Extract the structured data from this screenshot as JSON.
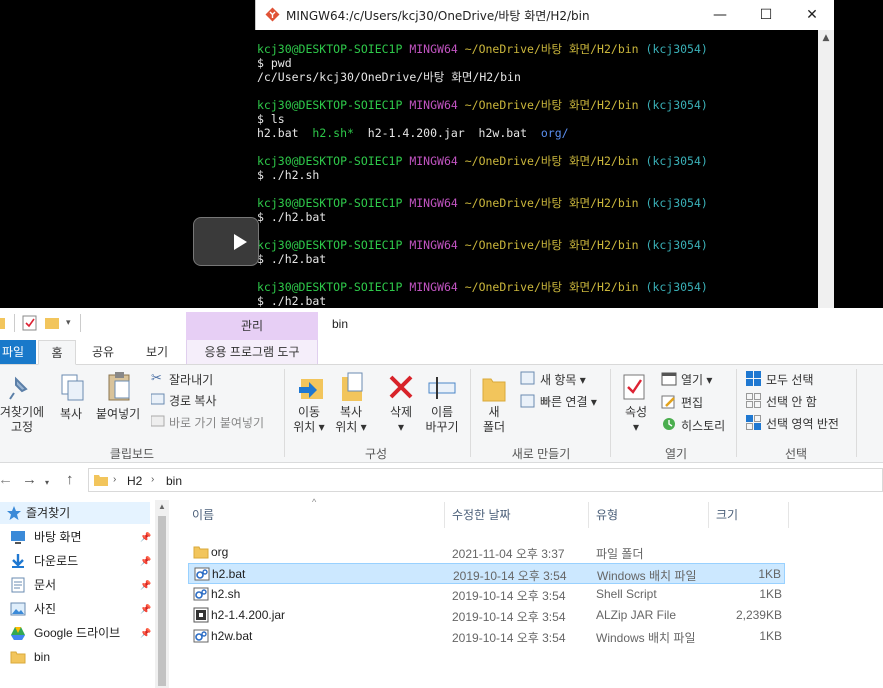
{
  "terminal": {
    "title": "MINGW64:/c/Users/kcj30/OneDrive/바탕 화면/H2/bin",
    "controls": {
      "minimize": "—",
      "maximize": "☐",
      "close": "✕"
    },
    "lines": [
      {
        "parts": [
          {
            "t": "kcj30@DESKTOP-SOIEC1P ",
            "c": "g"
          },
          {
            "t": "MINGW64 ",
            "c": "m"
          },
          {
            "t": "~/OneDrive/바탕 화면/H2/bin ",
            "c": "y"
          },
          {
            "t": "(kcj3054)",
            "c": "c"
          }
        ]
      },
      {
        "parts": [
          {
            "t": "$ pwd"
          }
        ]
      },
      {
        "parts": [
          {
            "t": "/c/Users/kcj30/OneDrive/바탕 화면/H2/bin"
          }
        ]
      },
      {
        "parts": [
          {
            "t": ""
          }
        ]
      },
      {
        "parts": [
          {
            "t": "kcj30@DESKTOP-SOIEC1P ",
            "c": "g"
          },
          {
            "t": "MINGW64 ",
            "c": "m"
          },
          {
            "t": "~/OneDrive/바탕 화면/H2/bin ",
            "c": "y"
          },
          {
            "t": "(kcj3054)",
            "c": "c"
          }
        ]
      },
      {
        "parts": [
          {
            "t": "$ ls"
          }
        ]
      },
      {
        "parts": [
          {
            "t": "h2.bat  "
          },
          {
            "t": "h2.sh*",
            "c": "g"
          },
          {
            "t": "  h2-1.4.200.jar  h2w.bat  "
          },
          {
            "t": "org/",
            "c": "b"
          }
        ]
      },
      {
        "parts": [
          {
            "t": ""
          }
        ]
      },
      {
        "parts": [
          {
            "t": "kcj30@DESKTOP-SOIEC1P ",
            "c": "g"
          },
          {
            "t": "MINGW64 ",
            "c": "m"
          },
          {
            "t": "~/OneDrive/바탕 화면/H2/bin ",
            "c": "y"
          },
          {
            "t": "(kcj3054)",
            "c": "c"
          }
        ]
      },
      {
        "parts": [
          {
            "t": "$ ./h2.sh"
          }
        ]
      },
      {
        "parts": [
          {
            "t": ""
          }
        ]
      },
      {
        "parts": [
          {
            "t": "kcj30@DESKTOP-SOIEC1P ",
            "c": "g"
          },
          {
            "t": "MINGW64 ",
            "c": "m"
          },
          {
            "t": "~/OneDrive/바탕 화면/H2/bin ",
            "c": "y"
          },
          {
            "t": "(kcj3054)",
            "c": "c"
          }
        ]
      },
      {
        "parts": [
          {
            "t": "$ ./h2.bat"
          }
        ]
      },
      {
        "parts": [
          {
            "t": ""
          }
        ]
      },
      {
        "parts": [
          {
            "t": "kcj30@DESKTOP-SOIEC1P ",
            "c": "g"
          },
          {
            "t": "MINGW64 ",
            "c": "m"
          },
          {
            "t": "~/OneDrive/바탕 화면/H2/bin ",
            "c": "y"
          },
          {
            "t": "(kcj3054)",
            "c": "c"
          }
        ]
      },
      {
        "parts": [
          {
            "t": "$ ./h2.bat"
          }
        ]
      },
      {
        "parts": [
          {
            "t": ""
          }
        ]
      },
      {
        "parts": [
          {
            "t": "kcj30@DESKTOP-SOIEC1P ",
            "c": "g"
          },
          {
            "t": "MINGW64 ",
            "c": "m"
          },
          {
            "t": "~/OneDrive/바탕 화면/H2/bin ",
            "c": "y"
          },
          {
            "t": "(kcj3054)",
            "c": "c"
          }
        ]
      },
      {
        "parts": [
          {
            "t": "$ ./h2.bat"
          }
        ]
      }
    ]
  },
  "explorer": {
    "window_title": "bin",
    "context_header": "관리",
    "tabs": {
      "file": "파일",
      "home": "홈",
      "share": "공유",
      "view": "보기",
      "manage": "응용 프로그램 도구"
    },
    "ribbon": {
      "pin": [
        "겨찾기에",
        "고정"
      ],
      "copy": "복사",
      "paste": "붙여넣기",
      "cut": "잘라내기",
      "copy_path": "경로 복사",
      "paste_shortcut": "바로 가기 붙여넣기",
      "clipboard_group": "클립보드",
      "move_to": [
        "이동",
        "위치 ▾"
      ],
      "copy_to": [
        "복사",
        "위치 ▾"
      ],
      "delete": [
        "삭제",
        "▾"
      ],
      "rename": [
        "이름",
        "바꾸기"
      ],
      "organize_group": "구성",
      "new_folder": [
        "새",
        "폴더"
      ],
      "new_item": "새 항목 ▾",
      "easy_access": "빠른 연결 ▾",
      "new_group": "새로 만들기",
      "properties": [
        "속성",
        "▾"
      ],
      "open": "열기 ▾",
      "edit": "편집",
      "history": "히스토리",
      "open_group": "열기",
      "select_all": "모두 선택",
      "select_none": "선택 안 함",
      "invert_selection": "선택 영역 반전",
      "select_group": "선택"
    },
    "address": {
      "back": "←",
      "forward": "→",
      "up": "↑",
      "segments": [
        "H2",
        "bin"
      ]
    },
    "nav": [
      {
        "label": "즐겨찾기",
        "icon": "star-icon",
        "pinned": false
      },
      {
        "label": "바탕 화면",
        "icon": "desktop-icon",
        "pinned": true
      },
      {
        "label": "다운로드",
        "icon": "download-icon",
        "pinned": true
      },
      {
        "label": "문서",
        "icon": "document-icon",
        "pinned": true
      },
      {
        "label": "사진",
        "icon": "picture-icon",
        "pinned": true
      },
      {
        "label": "Google 드라이브",
        "icon": "google-drive-icon",
        "pinned": true
      },
      {
        "label": "bin",
        "icon": "folder-icon",
        "pinned": false
      }
    ],
    "columns": {
      "name": "이름",
      "date": "수정한 날짜",
      "type": "유형",
      "size": "크기"
    },
    "files": [
      {
        "name": "org",
        "date": "2021-11-04 오후 3:37",
        "type": "파일 폴더",
        "size": "",
        "icon": "folder-icon",
        "selected": false
      },
      {
        "name": "h2.bat",
        "date": "2019-10-14 오후 3:54",
        "type": "Windows 배치 파일",
        "size": "1KB",
        "icon": "batch-file-icon",
        "selected": true
      },
      {
        "name": "h2.sh",
        "date": "2019-10-14 오후 3:54",
        "type": "Shell Script",
        "size": "1KB",
        "icon": "script-file-icon",
        "selected": false
      },
      {
        "name": "h2-1.4.200.jar",
        "date": "2019-10-14 오후 3:54",
        "type": "ALZip JAR File",
        "size": "2,239KB",
        "icon": "jar-file-icon",
        "selected": false
      },
      {
        "name": "h2w.bat",
        "date": "2019-10-14 오후 3:54",
        "type": "Windows 배치 파일",
        "size": "1KB",
        "icon": "batch-file-icon",
        "selected": false
      }
    ],
    "colors": {
      "file_tab": "#1979ca",
      "context_header": "#e7cff5",
      "selection": "#cce8ff"
    }
  }
}
